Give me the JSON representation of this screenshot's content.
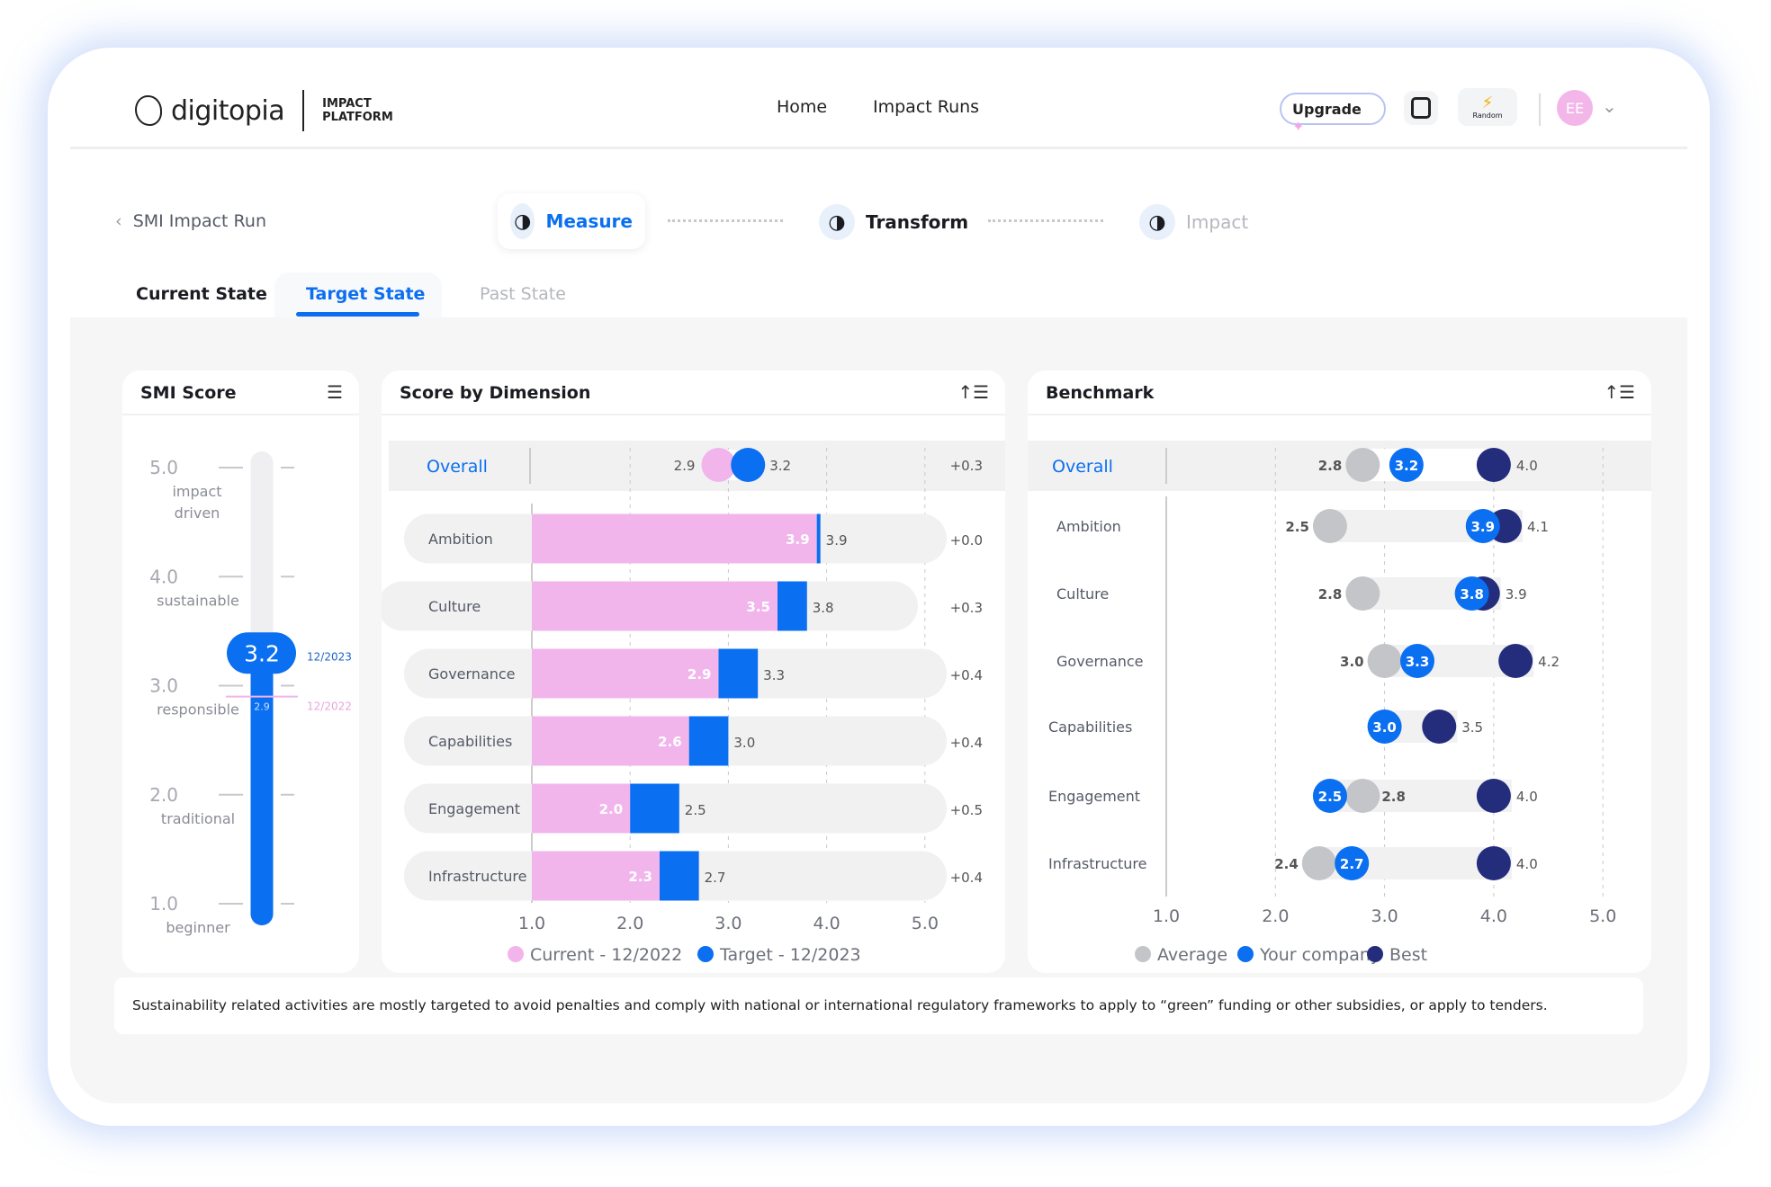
{
  "header": {
    "logo": "digitopia",
    "logo_sub_1": "IMPACT",
    "logo_sub_2": "PLATFORM",
    "nav": [
      "Home",
      "Impact Runs"
    ],
    "upgrade": "Upgrade",
    "org_label": "Random",
    "avatar": "EE"
  },
  "breadcrumb": "SMI Impact Run",
  "steps": [
    "Measure",
    "Transform",
    "Impact"
  ],
  "tabs": [
    "Current State",
    "Target State",
    "Past State"
  ],
  "active_tab": "Target State",
  "colors": {
    "current": "#f1b5ec",
    "target": "#0a6ff0",
    "average": "#c4c5c9",
    "best": "#232d7c",
    "accent": "#0a6ff0"
  },
  "smi": {
    "title": "SMI Score",
    "value": "3.2",
    "current_value": "2.9",
    "target_date": "12/2023",
    "current_date": "12/2022",
    "levels": [
      {
        "v": "5.0",
        "l": "impact driven"
      },
      {
        "v": "4.0",
        "l": "sustainable"
      },
      {
        "v": "3.0",
        "l": "responsible"
      },
      {
        "v": "2.0",
        "l": "traditional"
      },
      {
        "v": "1.0",
        "l": "beginner"
      }
    ]
  },
  "chart_data": [
    {
      "type": "bar",
      "title": "Score by Dimension",
      "xlim": [
        1,
        5
      ],
      "ticks": [
        "1.0",
        "2.0",
        "3.0",
        "4.0",
        "5.0"
      ],
      "overall": {
        "label": "Overall",
        "current": 2.9,
        "target": 3.2,
        "delta": "+0.3"
      },
      "categories": [
        "Ambition",
        "Culture",
        "Governance",
        "Capabilities",
        "Engagement",
        "Infrastructure"
      ],
      "series": [
        {
          "name": "Current - 12/2022",
          "values": [
            3.9,
            3.5,
            2.9,
            2.6,
            2.0,
            2.3
          ]
        },
        {
          "name": "Target - 12/2023",
          "values": [
            3.9,
            3.8,
            3.3,
            3.0,
            2.5,
            2.7
          ]
        }
      ],
      "deltas": [
        "+0.0",
        "+0.3",
        "+0.4",
        "+0.4",
        "+0.5",
        "+0.4"
      ],
      "legend": "bottom"
    },
    {
      "type": "scatter",
      "title": "Benchmark",
      "xlim": [
        1,
        5
      ],
      "ticks": [
        "1.0",
        "2.0",
        "3.0",
        "4.0",
        "5.0"
      ],
      "overall": {
        "label": "Overall",
        "average": 2.8,
        "company": 3.2,
        "best": 4.0
      },
      "categories": [
        "Ambition",
        "Culture",
        "Governance",
        "Capabilities",
        "Engagement",
        "Infrastructure"
      ],
      "series": [
        {
          "name": "Average",
          "values": [
            2.5,
            2.8,
            3.0,
            null,
            2.8,
            2.4
          ]
        },
        {
          "name": "Your company",
          "values": [
            3.9,
            3.8,
            3.3,
            3.0,
            2.5,
            2.7
          ]
        },
        {
          "name": "Best",
          "values": [
            4.1,
            3.9,
            4.2,
            3.5,
            4.0,
            4.0
          ]
        }
      ],
      "legend": "bottom"
    }
  ],
  "footer": "Sustainability related activities are mostly targeted to avoid penalties and comply with national or international regulatory frameworks to apply to “green” funding or other subsidies, or apply to tenders."
}
